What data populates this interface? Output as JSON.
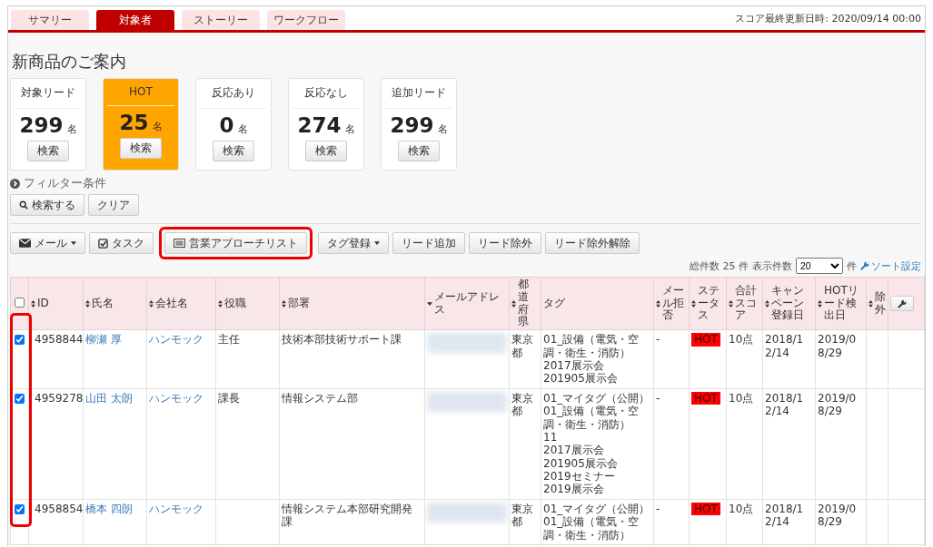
{
  "tabs": [
    {
      "label": "サマリー",
      "selected": false
    },
    {
      "label": "対象者",
      "selected": true
    },
    {
      "label": "ストーリー",
      "selected": false
    },
    {
      "label": "ワークフロー",
      "selected": false
    }
  ],
  "score_updated": "スコア最終更新日時: 2020/09/14 00:00",
  "page_title": "新商品のご案内",
  "cards": [
    {
      "label": "対象リード",
      "count": "299",
      "unit": "名",
      "button": "検索",
      "selected": false
    },
    {
      "label": "HOT",
      "count": "25",
      "unit": "名",
      "button": "検索",
      "selected": true
    },
    {
      "label": "反応あり",
      "count": "0",
      "unit": "名",
      "button": "検索",
      "selected": false
    },
    {
      "label": "反応なし",
      "count": "274",
      "unit": "名",
      "button": "検索",
      "selected": false
    },
    {
      "label": "追加リード",
      "count": "299",
      "unit": "名",
      "button": "検索",
      "selected": false
    }
  ],
  "filter": {
    "label": "フィルター条件",
    "expanded": false,
    "search_button": "検索する",
    "clear_button": "クリア"
  },
  "toolbar": [
    {
      "label": "メール",
      "has_menu": true,
      "highlighted": false
    },
    {
      "label": "タスク",
      "has_menu": false,
      "highlighted": false
    },
    {
      "label": "営業アプローチリスト",
      "has_menu": false,
      "highlighted": true
    },
    {
      "label": "タグ登録",
      "has_menu": true,
      "highlighted": false
    },
    {
      "label": "リード追加",
      "has_menu": false,
      "highlighted": false
    },
    {
      "label": "リード除外",
      "has_menu": false,
      "highlighted": false
    },
    {
      "label": "リード除外解除",
      "has_menu": false,
      "highlighted": false
    }
  ],
  "paging": {
    "total": "総件数 25 件",
    "per_page_label": "表示件数",
    "per_page": "20",
    "unit": "件",
    "sort_link": "ソート設定"
  },
  "table": {
    "columns": [
      {
        "kind": "checkbox",
        "checked": false
      },
      {
        "kind": "text",
        "label": "ID",
        "sortable": true,
        "sorted": false
      },
      {
        "kind": "text",
        "label": "氏名",
        "sortable": true,
        "sorted": false
      },
      {
        "kind": "text",
        "label": "会社名",
        "sortable": true,
        "sorted": false
      },
      {
        "kind": "text",
        "label": "役職",
        "sortable": true,
        "sorted": false
      },
      {
        "kind": "text",
        "label": "部署",
        "sortable": true,
        "sorted": false
      },
      {
        "kind": "text",
        "label": "メールアドレス",
        "sortable": true,
        "sorted": true
      },
      {
        "kind": "text",
        "label": "都道府県",
        "sortable": true,
        "sorted": false
      },
      {
        "kind": "text",
        "label": "タグ",
        "sortable": false,
        "sorted": false
      },
      {
        "kind": "text",
        "label": "メール拒否",
        "sortable": true,
        "sorted": false
      },
      {
        "kind": "text",
        "label": "ステータス",
        "sortable": true,
        "sorted": false
      },
      {
        "kind": "text",
        "label": "合計スコア",
        "sortable": true,
        "sorted": false
      },
      {
        "kind": "text",
        "label": "キャンペーン登録日",
        "sortable": true,
        "sorted": false
      },
      {
        "kind": "text",
        "label": "HOTリード検出日",
        "sortable": true,
        "sorted": false
      },
      {
        "kind": "text",
        "label": "除外",
        "sortable": true,
        "sorted": false
      },
      {
        "kind": "settings"
      }
    ],
    "rows": [
      {
        "checked": true,
        "id": "4958844",
        "name": "柳瀬 厚",
        "company": "ハンモック",
        "position": "主任",
        "department": "技術本部技術サポート課",
        "prefecture": "東京都",
        "tags": [
          "01_設備（電気・空調・衛生・消防）",
          "2017展示会",
          "201905展示会"
        ],
        "mail_refusal": "-",
        "status": "HOT",
        "score": "10点",
        "campaign_date": "2018/12/14",
        "hot_date": "2019/08/29"
      },
      {
        "checked": true,
        "id": "4959278",
        "name": "山田 太朗",
        "company": "ハンモック",
        "position": "課長",
        "department": "情報システム部",
        "prefecture": "東京都",
        "tags": [
          "01_マイタグ（公開）",
          "01_設備（電気・空調・衛生・消防）",
          "11",
          "2017展示会",
          "201905展示会",
          "2019セミナー",
          "2019展示会"
        ],
        "mail_refusal": "-",
        "status": "HOT",
        "score": "10点",
        "campaign_date": "2018/12/14",
        "hot_date": "2019/08/29"
      },
      {
        "checked": true,
        "id": "4958854",
        "name": "橋本 四朗",
        "company": "ハンモック",
        "position": "",
        "department": "情報システム本部研究開発課",
        "prefecture": "東京都",
        "tags": [
          "01_マイタグ（公開）",
          "01_設備（電気・空調・衛生・消防）"
        ],
        "mail_refusal": "-",
        "status": "HOT",
        "score": "10点",
        "campaign_date": "2018/12/14",
        "hot_date": "2019/08/29"
      }
    ],
    "checkbox_column_highlighted": true
  }
}
